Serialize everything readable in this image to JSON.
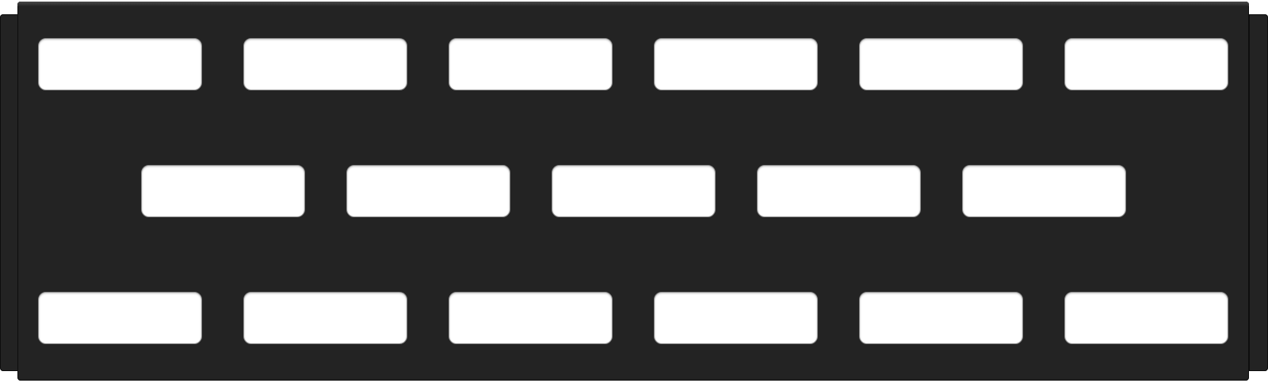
{
  "panel": {
    "color": "#232323",
    "slot_color": "#ffffff",
    "rows": [
      {
        "slot_count": 6
      },
      {
        "slot_count": 5
      },
      {
        "slot_count": 6
      }
    ]
  }
}
